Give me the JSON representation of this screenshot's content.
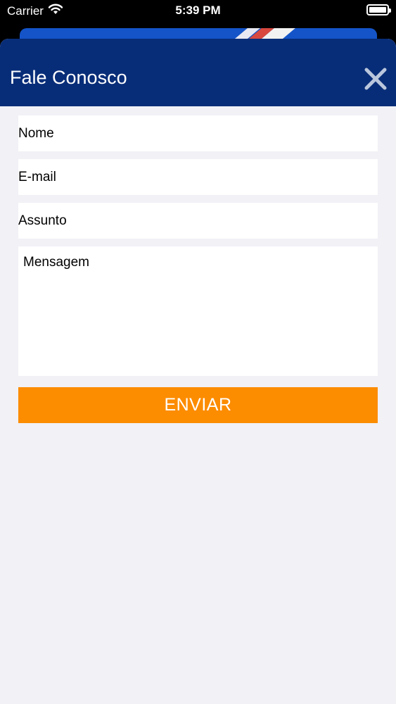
{
  "status_bar": {
    "carrier": "Carrier",
    "time": "5:39 PM",
    "wifi_icon": "wifi-icon",
    "battery_icon": "battery-icon"
  },
  "modal": {
    "title": "Fale Conosco",
    "close_icon": "close-icon"
  },
  "form": {
    "name_placeholder": "Nome",
    "email_placeholder": "E-mail",
    "subject_placeholder": "Assunto",
    "message_placeholder": "Mensagem",
    "submit_label": "ENVIAR"
  },
  "colors": {
    "header": "#082d78",
    "submit": "#fc8c00",
    "background": "#f1f1f6"
  }
}
